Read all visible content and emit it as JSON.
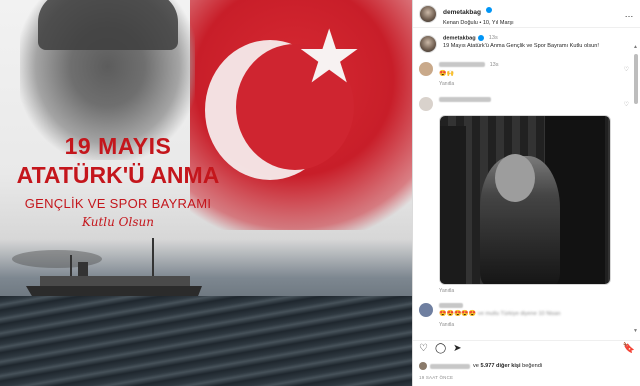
{
  "image": {
    "line1": "19 MAYIS",
    "line2": "ATATÜRK'Ü ANMA",
    "line3": "GENÇLİK VE SPOR BAYRAMI",
    "line4": "Kutlu Olsun"
  },
  "header": {
    "username": "demetakbag",
    "location": "Kenan Doğulu • 10, Yıl Marşı",
    "more_icon": "…"
  },
  "caption": {
    "username": "demetakbag",
    "time": "13s",
    "text": "19 Mayıs Atatürk'ü Anma Gençlik ve Spor Bayramı Kutlu olsun!"
  },
  "comments": [
    {
      "emojis": "😍🙌",
      "time": "13s",
      "reply": "Yanıtla"
    },
    {
      "reply": "Yanıtla"
    },
    {
      "emojis": "😍😍😍😍😍",
      "text": "ve mutlu Türkiye diyene 10 Nisan",
      "reply": "Yanıtla"
    }
  ],
  "actions": {
    "like_icon": "♡",
    "comment_icon": "◯",
    "share_icon": "➤",
    "save_icon": "🔖"
  },
  "likes": {
    "prefix": "ve",
    "count": "5.977 diğer kişi",
    "suffix": "beğendi"
  },
  "date": "19 SAAT ÖNCE",
  "colors": {
    "title_red": "#c4161c",
    "verified_blue": "#0095f6",
    "flag_red": "#c81e29"
  }
}
